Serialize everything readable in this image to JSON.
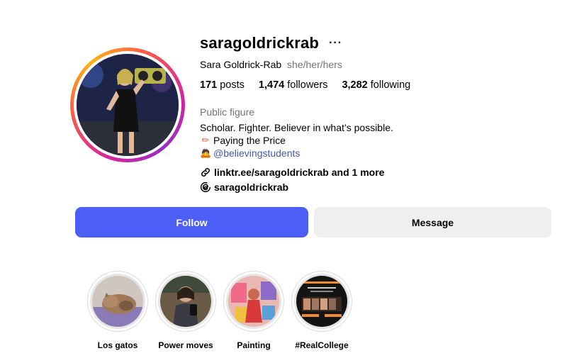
{
  "profile": {
    "username": "saragoldrickrab",
    "more_icon": "more-horizontal-icon",
    "full_name": "Sara Goldrick-Rab",
    "pronouns": "she/her/hers",
    "stats": {
      "posts_count": "171",
      "posts_label": "posts",
      "followers_count": "1,474",
      "followers_label": "followers",
      "following_count": "3,282",
      "following_label": "following"
    },
    "category": "Public figure",
    "bio": {
      "line1": "Scholar. Fighter. Believer in what’s possible.",
      "line2_emoji": "✏",
      "line2": "Paying the Price",
      "line3_emoji": "🙇",
      "line3": "@believingstudents"
    },
    "links": {
      "link_text": "linktr.ee/saragoldrickrab and 1 more",
      "link_icon": "link-icon",
      "threads_text": "saragoldrickrab",
      "threads_icon": "threads-icon"
    }
  },
  "actions": {
    "follow_label": "Follow",
    "message_label": "Message"
  },
  "highlights": [
    {
      "label": "Los gatos"
    },
    {
      "label": "Power moves"
    },
    {
      "label": "Painting"
    },
    {
      "label": "#RealCollege"
    }
  ],
  "colors": {
    "follow_button": "#4d5ef7",
    "message_button": "#efefef",
    "secondary_text": "#737373",
    "bio_link": "#4558a8"
  }
}
